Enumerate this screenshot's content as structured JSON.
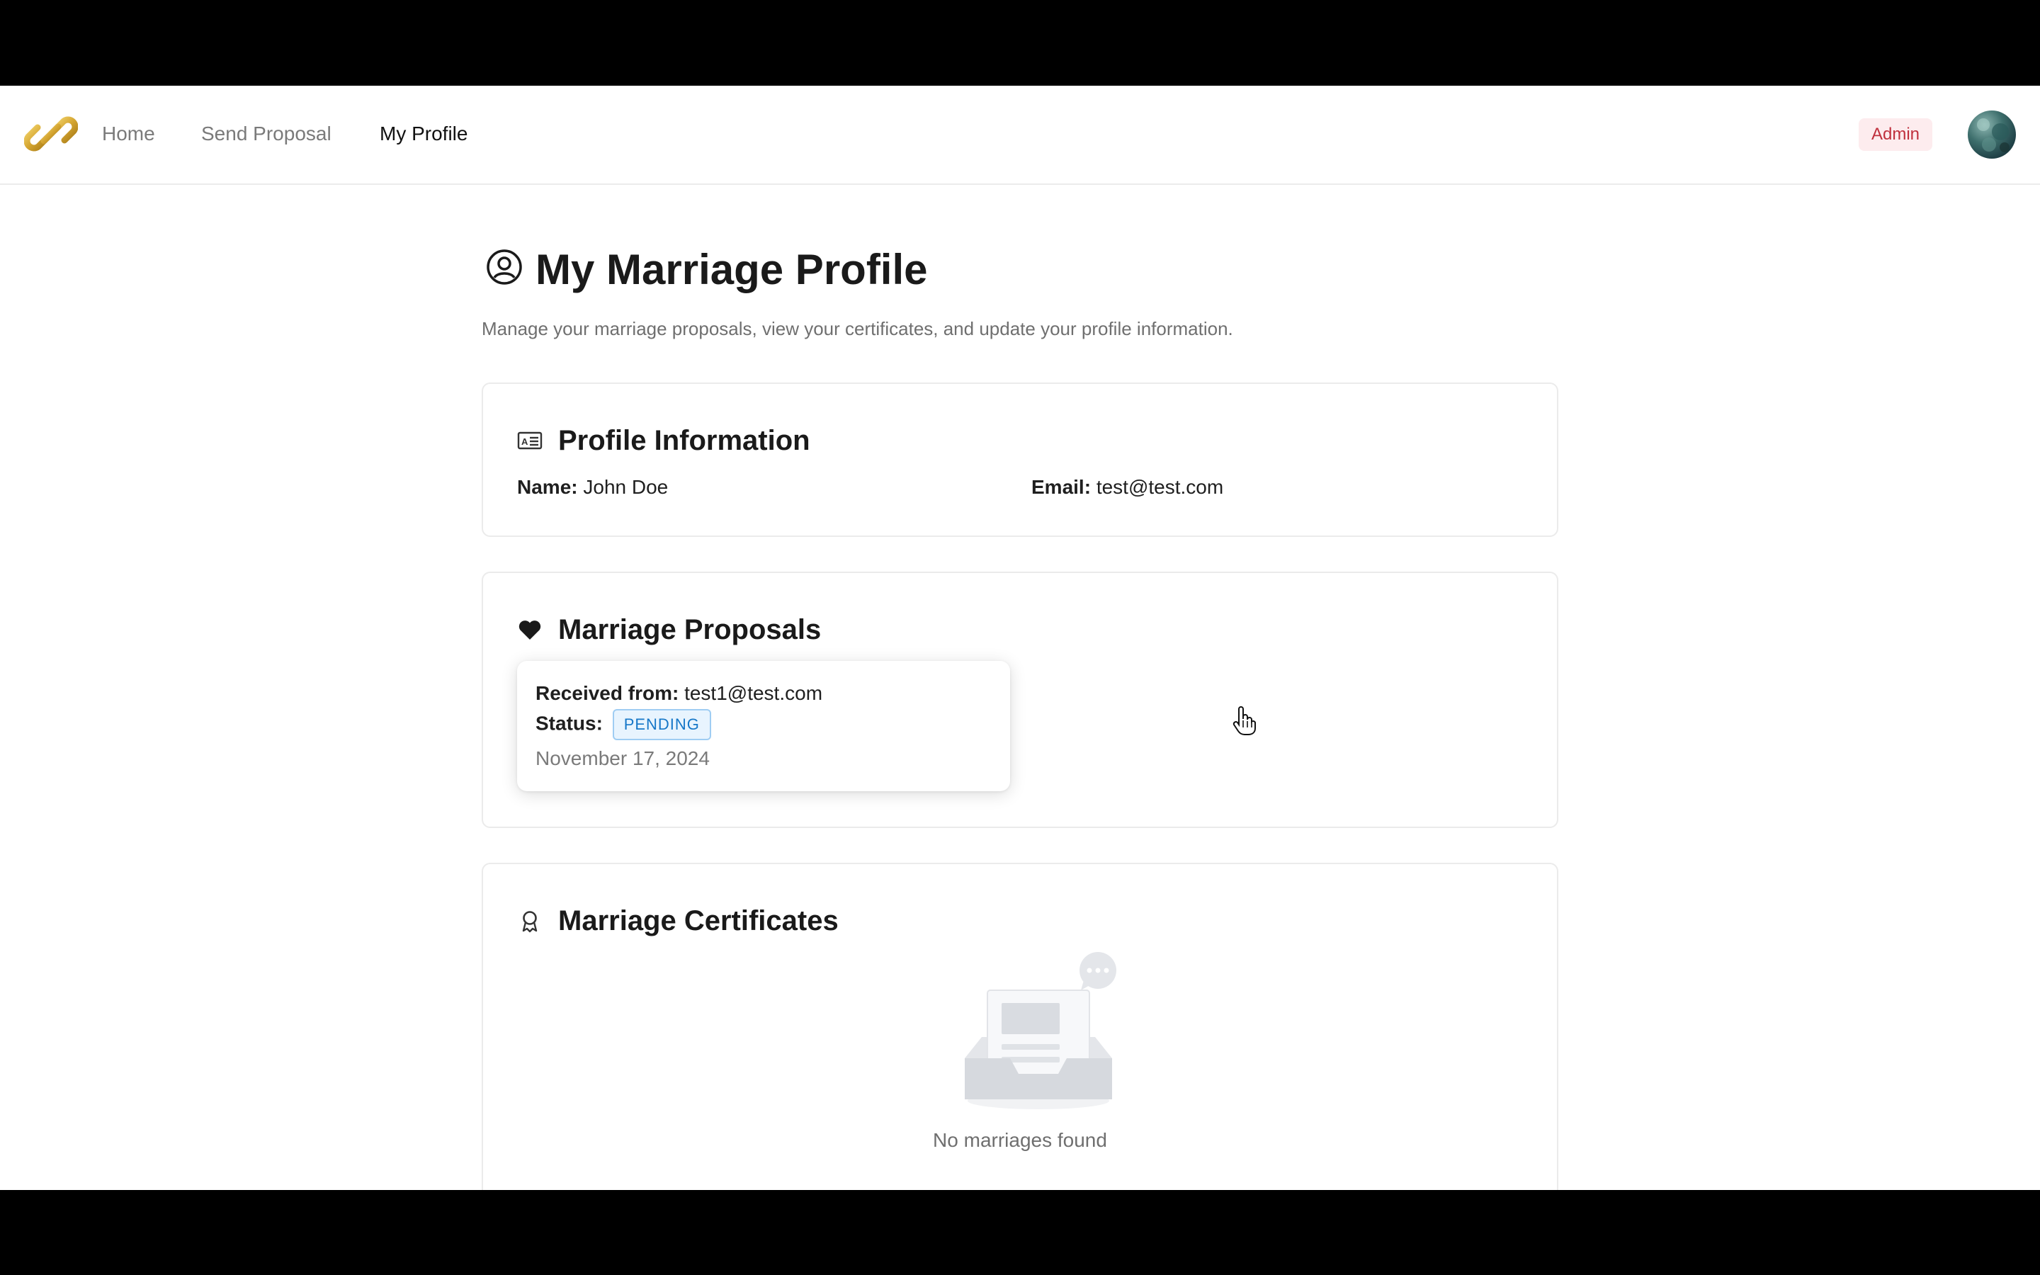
{
  "nav": {
    "items": [
      {
        "label": "Home"
      },
      {
        "label": "Send Proposal"
      },
      {
        "label": "My Profile"
      }
    ],
    "admin_badge": "Admin",
    "logo_icon": "chain-link-icon",
    "avatar_icon": "user-avatar"
  },
  "page": {
    "title": "My Marriage Profile",
    "subtitle": "Manage your marriage proposals, view your certificates, and update your profile information."
  },
  "profile": {
    "title": "Profile Information",
    "name_label": "Name:",
    "name_value": "John Doe",
    "email_label": "Email:",
    "email_value": "test@test.com"
  },
  "proposals": {
    "title": "Marriage Proposals",
    "items": [
      {
        "received_label": "Received from:",
        "received_value": "test1@test.com",
        "status_label": "Status:",
        "status_value": "PENDING",
        "date": "November 17, 2024"
      }
    ]
  },
  "certificates": {
    "title": "Marriage Certificates",
    "empty_text": "No marriages found"
  },
  "colors": {
    "admin_badge_bg": "#fdecee",
    "admin_badge_text": "#c0303d",
    "status_pending_text": "#1677c8",
    "status_pending_bg": "#e8f4fe",
    "logo_gold": "#d4a531"
  }
}
